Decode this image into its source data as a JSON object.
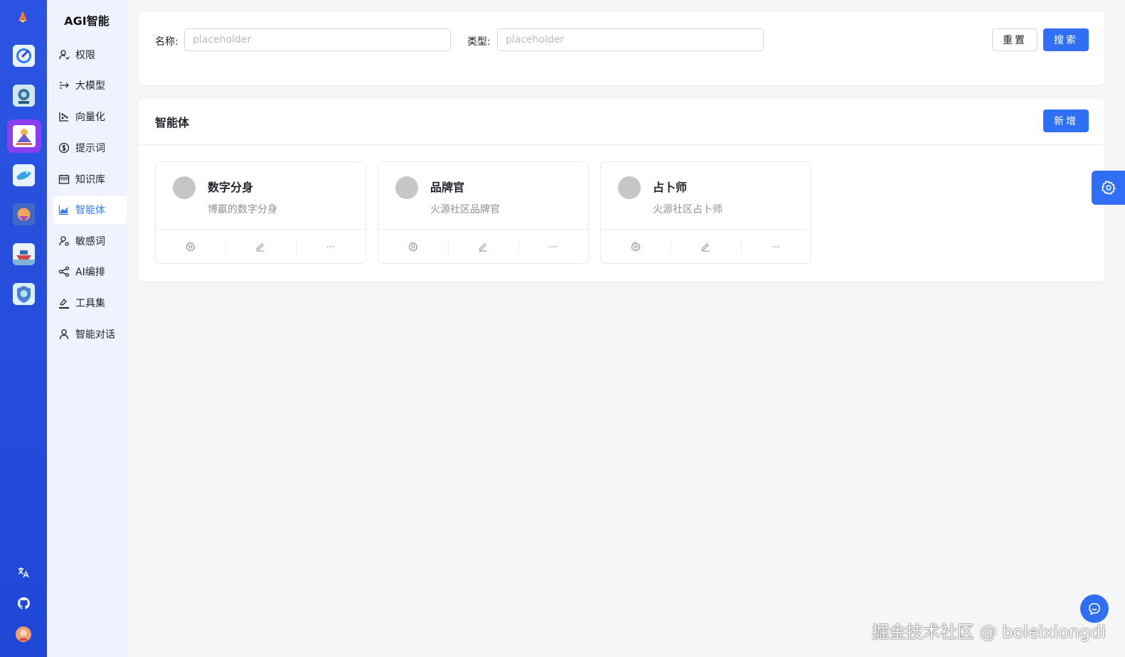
{
  "rail": {
    "apps": [
      "brand-logo",
      "app-1",
      "app-2",
      "app-3-active",
      "app-4",
      "app-5",
      "app-6",
      "app-7"
    ],
    "bottom_icons": [
      "translate-icon",
      "github-icon",
      "user-avatar"
    ],
    "colors": {
      "background": "#2a55e0",
      "active": "#8a3ff0"
    }
  },
  "nav": {
    "title": "AGI智能",
    "items": [
      {
        "label": "权限",
        "icon": "user-lock-icon"
      },
      {
        "label": "大模型",
        "icon": "arrows-icon"
      },
      {
        "label": "向量化",
        "icon": "scatter-icon"
      },
      {
        "label": "提示词",
        "icon": "dollar-circle-icon"
      },
      {
        "label": "知识库",
        "icon": "calendar-icon"
      },
      {
        "label": "智能体",
        "icon": "area-chart-icon",
        "active": true
      },
      {
        "label": "敏感词",
        "icon": "user-settings-icon"
      },
      {
        "label": "AI编排",
        "icon": "share-icon"
      },
      {
        "label": "工具集",
        "icon": "brush-icon"
      },
      {
        "label": "智能对话",
        "icon": "user-icon"
      }
    ]
  },
  "search": {
    "name_label": "名称:",
    "name_placeholder": "placeholder",
    "type_label": "类型:",
    "type_placeholder": "placeholder",
    "reset_label": "重置",
    "search_label": "搜索"
  },
  "agents": {
    "title": "智能体",
    "add_label": "新增",
    "cards": [
      {
        "name": "数字分身",
        "desc": "博嬴的数字分身"
      },
      {
        "name": "品牌官",
        "desc": "火源社区品牌官"
      },
      {
        "name": "占卜师",
        "desc": "火源社区占卜师"
      }
    ],
    "actions": [
      "gear-icon",
      "edit-icon",
      "more-icon"
    ]
  },
  "watermark": "掘金技术社区 @ boleixiongdi",
  "colors": {
    "primary": "#2f6ff3",
    "nav_bg": "#eef3ff"
  }
}
